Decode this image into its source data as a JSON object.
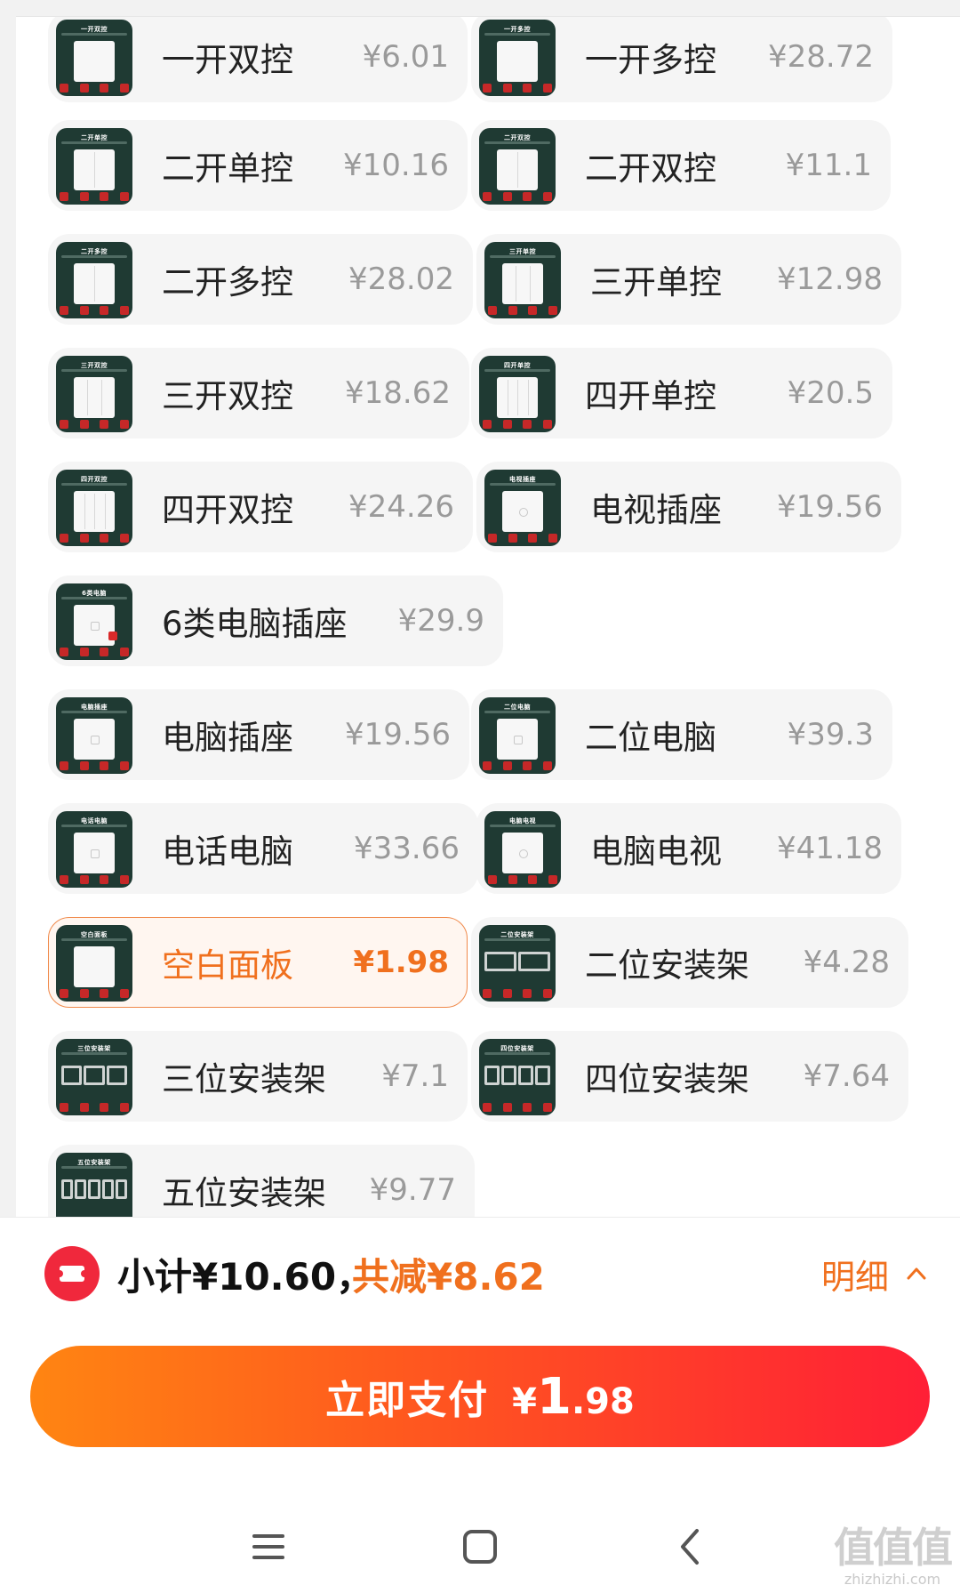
{
  "products": [
    {
      "name": "一开双控",
      "price": "¥6.01",
      "cap": "一开双控",
      "seg": 0,
      "kind": "switch"
    },
    {
      "name": "一开多控",
      "price": "¥28.72",
      "cap": "一开多控",
      "seg": 0,
      "kind": "switch"
    },
    {
      "name": "二开单控",
      "price": "¥10.16",
      "cap": "二开单控",
      "seg": 1,
      "kind": "switch"
    },
    {
      "name": "二开双控",
      "price": "¥11.1",
      "cap": "二开双控",
      "seg": 1,
      "kind": "switch"
    },
    {
      "name": "二开多控",
      "price": "¥28.02",
      "cap": "二开多控",
      "seg": 1,
      "kind": "switch"
    },
    {
      "name": "三开单控",
      "price": "¥12.98",
      "cap": "三开单控",
      "seg": 2,
      "kind": "switch"
    },
    {
      "name": "三开双控",
      "price": "¥18.62",
      "cap": "三开双控",
      "seg": 2,
      "kind": "switch"
    },
    {
      "name": "四开单控",
      "price": "¥20.5",
      "cap": "四开单控",
      "seg": 3,
      "kind": "switch"
    },
    {
      "name": "四开双控",
      "price": "¥24.26",
      "cap": "四开双控",
      "seg": 3,
      "kind": "switch"
    },
    {
      "name": "电视插座",
      "price": "¥19.56",
      "cap": "电视插座",
      "seg": 0,
      "kind": "tv"
    },
    {
      "name": "6类电脑插座",
      "price": "¥29.9",
      "cap": "6类电脑",
      "seg": 0,
      "kind": "cat6"
    },
    {
      "name": "电脑插座",
      "price": "¥19.56",
      "cap": "电脑插座",
      "seg": 0,
      "kind": "port"
    },
    {
      "name": "二位电脑",
      "price": "¥39.3",
      "cap": "二位电脑",
      "seg": 0,
      "kind": "port"
    },
    {
      "name": "电话电脑",
      "price": "¥33.66",
      "cap": "电话电脑",
      "seg": 0,
      "kind": "port"
    },
    {
      "name": "电脑电视",
      "price": "¥41.18",
      "cap": "电脑电视",
      "seg": 0,
      "kind": "tv"
    },
    {
      "name": "空白面板",
      "price": "¥1.98",
      "cap": "空白面板",
      "seg": 0,
      "kind": "blank",
      "selected": true
    },
    {
      "name": "二位安装架",
      "price": "¥4.28",
      "cap": "二位安装架",
      "frames": 2,
      "kind": "frame"
    },
    {
      "name": "三位安装架",
      "price": "¥7.1",
      "cap": "三位安装架",
      "frames": 3,
      "kind": "frame"
    },
    {
      "name": "四位安装架",
      "price": "¥7.64",
      "cap": "四位安装架",
      "frames": 4,
      "kind": "frame"
    },
    {
      "name": "五位安装架",
      "price": "¥9.77",
      "cap": "五位安装架",
      "frames": 5,
      "kind": "frame"
    }
  ],
  "footer": {
    "subtotal": "小计¥10.60，",
    "discount": "共减¥8.62",
    "detail": "明细",
    "pay_label": "立即支付",
    "pay_currency": "¥",
    "pay_int": "1",
    "pay_dec": ".98"
  },
  "watermark": {
    "big": "值值值",
    "small": "zhizhizhi.com"
  },
  "colors": {
    "accent": "#f0701e",
    "pay_start": "#ff8512",
    "pay_end": "#ff1f36",
    "thumb_bg": "#1f3a33"
  }
}
